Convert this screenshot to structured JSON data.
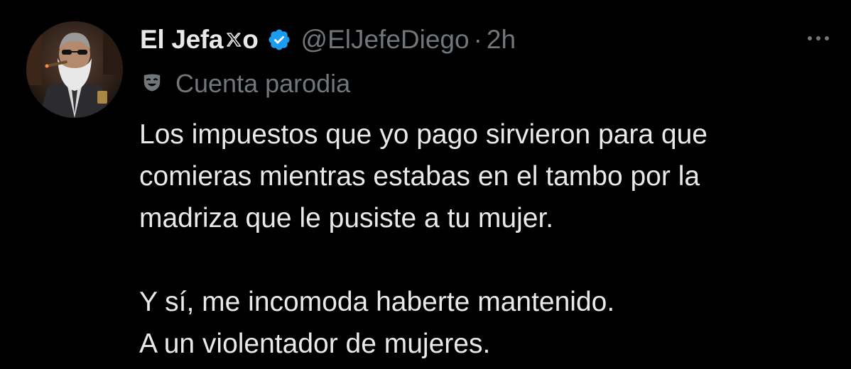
{
  "author": {
    "display_name": "El Jefa",
    "handle": "@ElJefeDiego",
    "separator": "·",
    "time": "2h",
    "avatar_icon": "bearded-man-with-cigar-avatar",
    "badge_icon": "verified-badge-icon",
    "badge_color": "#1d9bf0"
  },
  "parody": {
    "icon": "theater-mask-icon",
    "label": "Cuenta parodia"
  },
  "tweet": {
    "lines": [
      "Los impuestos que yo pago sirvieron para que",
      "comieras mientras estabas en el tambo por la",
      "madriza que le pusiste a tu mujer.",
      "",
      "Y sí, me incomoda haberte mantenido.",
      "A un violentador de mujeres."
    ]
  },
  "colors": {
    "background": "#000000",
    "primary_text": "#e7e9ea",
    "secondary_text": "#71767b"
  }
}
